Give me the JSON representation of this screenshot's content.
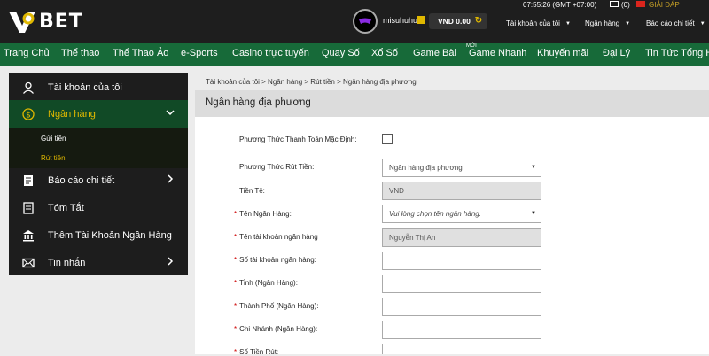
{
  "header": {
    "logo_text": "BET",
    "username": "misuhuhu",
    "balance": "VND 0.00",
    "time": "07:55:26 (GMT +07:00)",
    "mail_count": "(0)",
    "support": "GIẢI ĐÁP",
    "menus": [
      "Tài khoản của tôi",
      "Ngân hàng",
      "Báo cáo chi tiết"
    ]
  },
  "nav": {
    "items": [
      "Trang Chủ",
      "Thể thao",
      "Thể Thao Ảo",
      "e-Sports",
      "Casino trực tuyến",
      "Quay Số",
      "Xổ Số",
      "Game Bài",
      "Game Nhanh",
      "Khuyến mãi",
      "Đại Lý",
      "Tin Tức Tổng Hợ"
    ],
    "badge": "MỚI"
  },
  "sidebar": {
    "items": [
      {
        "label": "Tài khoản của tôi",
        "icon": "user-icon"
      },
      {
        "label": "Ngân hàng",
        "icon": "dollar-icon"
      },
      {
        "label": "Báo cáo chi tiết",
        "icon": "report-icon"
      },
      {
        "label": "Tóm Tắt",
        "icon": "summary-icon"
      },
      {
        "label": "Thêm Tài Khoản Ngân Hàng",
        "icon": "bank-icon"
      },
      {
        "label": "Tin nhắn",
        "icon": "message-icon"
      }
    ],
    "sub_items": [
      "Gửi tiền",
      "Rút tiền"
    ]
  },
  "breadcrumb": "Tài khoản của tôi > Ngân hàng > Rút tiền > Ngân hàng địa phương",
  "page_title": "Ngân hàng địa phương",
  "form": {
    "default_method_label": "Phương Thức Thanh Toán Mặc Định:",
    "withdraw_method_label": "Phương Thức Rút Tiền:",
    "withdraw_method_value": "Ngân hàng địa phương",
    "currency_label": "Tiền Tệ:",
    "currency_value": "VND",
    "bank_name_label": "Tên Ngân Hàng:",
    "bank_name_placeholder": "Vui lòng chọn tên ngân hàng.",
    "account_name_label": "Tên tài khoản ngân hàng",
    "account_name_value": "Nguyễn Thị An",
    "account_number_label": "Số tài khoản ngân hàng:",
    "province_label": "Tỉnh (Ngân Hàng):",
    "city_label": "Thành Phố (Ngân Hàng):",
    "branch_label": "Chi Nhánh (Ngân Hàng):",
    "amount_label": "Số Tiền Rút:",
    "required_mark": "*"
  },
  "colors": {
    "nav_green": "#176a39",
    "accent_gold": "#e0b800",
    "header_dark": "#1e1e1e"
  }
}
